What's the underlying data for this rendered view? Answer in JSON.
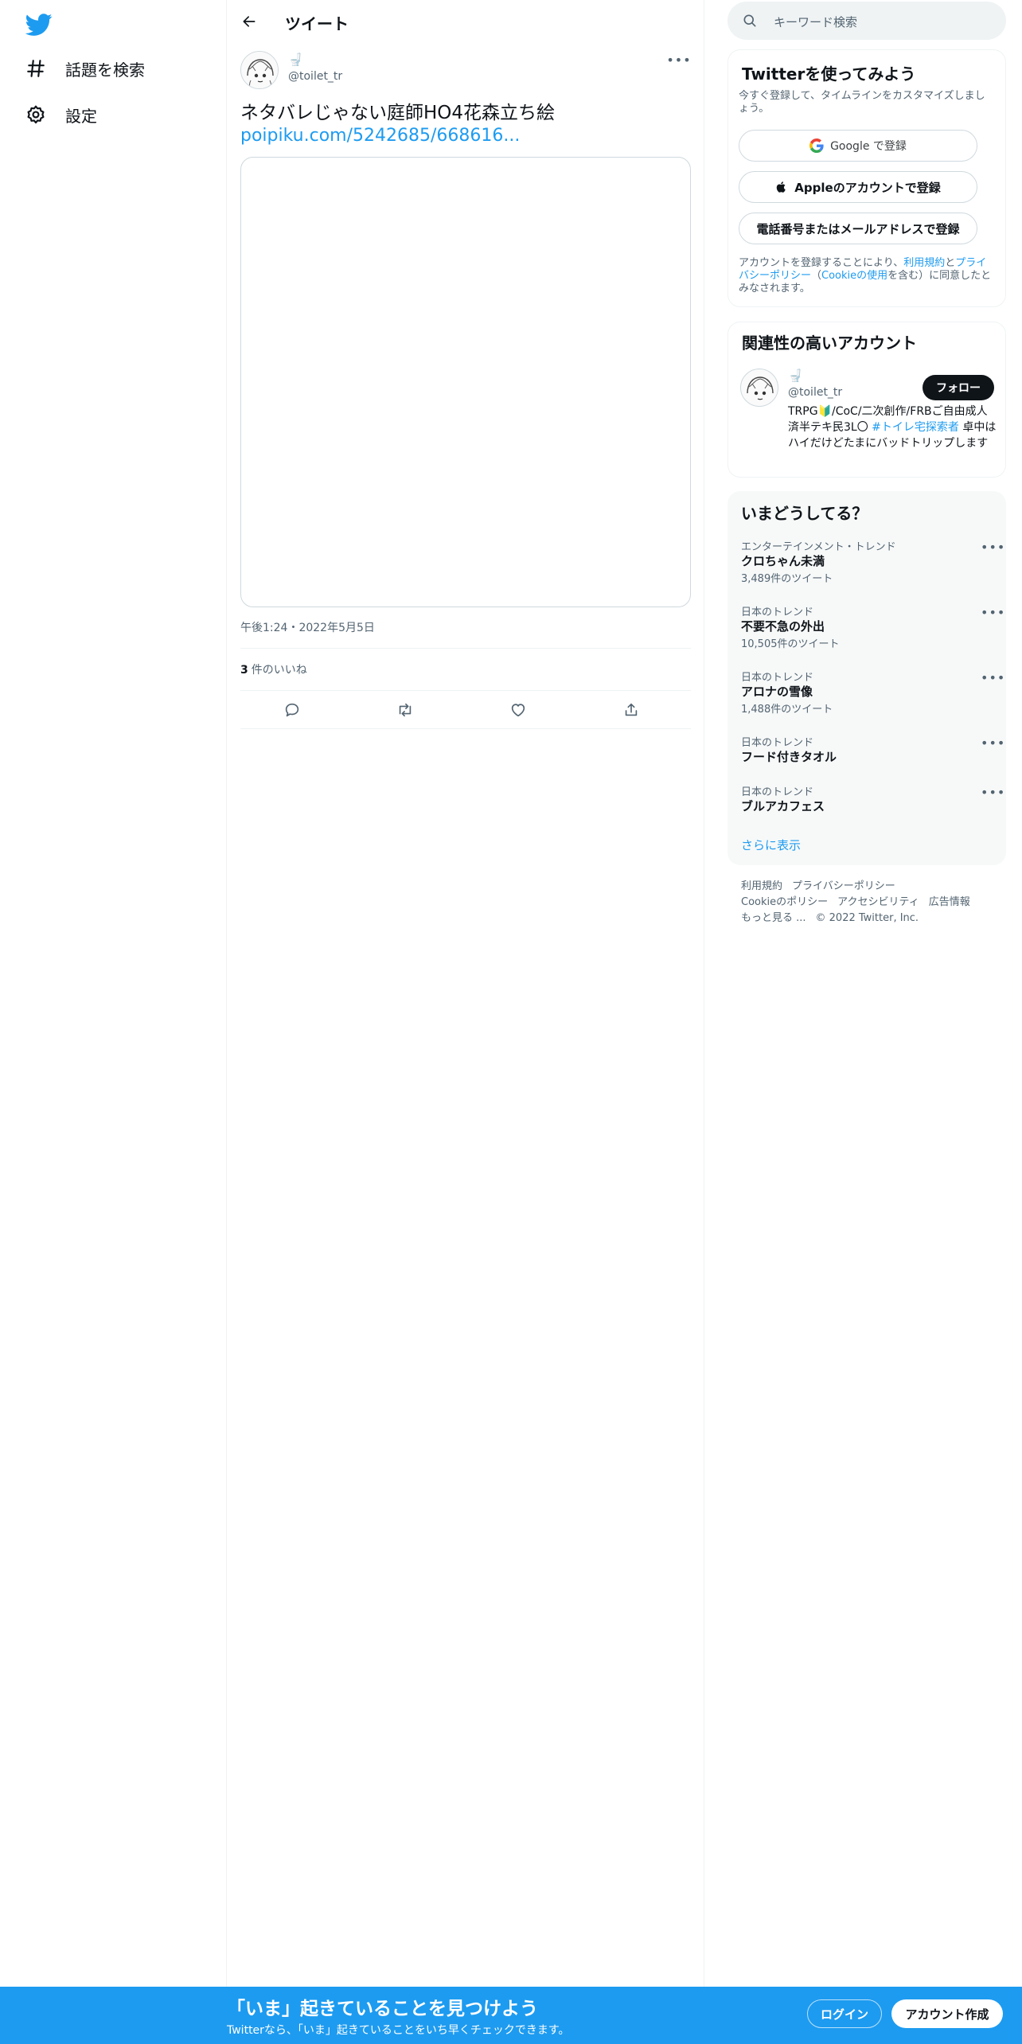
{
  "nav": {
    "explore_label": "話題を検索",
    "settings_label": "設定"
  },
  "header": {
    "title": "ツイート"
  },
  "tweet": {
    "author_name": "🚽",
    "author_handle": "@toilet_tr",
    "text": "ネタバレじゃない庭師HO4花森立ち絵",
    "link": "poipiku.com/5242685/668616...",
    "timestamp": "午後1:24・2022年5月5日",
    "likes_count": "3",
    "likes_label": "件のいいね"
  },
  "sidebar": {
    "search_placeholder": "キーワード検索",
    "signup_card": {
      "title": "Twitterを使ってみよう",
      "subtitle": "今すぐ登録して、タイムラインをカスタマイズしましょう。",
      "google_label": "Google で登録",
      "apple_label": "Appleのアカウントで登録",
      "phone_label": "電話番号またはメールアドレスで登録",
      "terms_prefix": "アカウントを登録することにより、",
      "terms_link": "利用規約",
      "terms_and": "と",
      "privacy_link": "プライバシーポリシー",
      "terms_paren_open": "（",
      "cookie_link": "Cookieの使用",
      "terms_suffix": "を含む）に同意したとみなされます。"
    },
    "related_card": {
      "title": "関連性の高いアカウント",
      "name": "🚽",
      "handle": "@toilet_tr",
      "follow_label": "フォロー",
      "bio": "TRPG🔰/CoC/二次創作/FRBご自由成人済半テキ民3L〇",
      "bio_hashtag": "#トイレ宅探索者",
      "bio_rest": "卓中はハイだけどたまにバッドトリップします"
    },
    "trends_card": {
      "title": "いまどうしてる？",
      "trends": [
        {
          "category": "エンターテインメント・トレンド",
          "name": "クロちゃん未満",
          "count": "3,489件のツイート"
        },
        {
          "category": "日本のトレンド",
          "name": "不要不急の外出",
          "count": "10,505件のツイート"
        },
        {
          "category": "日本のトレンド",
          "name": "アロナの雪像",
          "count": "1,488件のツイート"
        },
        {
          "category": "日本のトレンド",
          "name": "フード付きタオル",
          "count": ""
        },
        {
          "category": "日本のトレンド",
          "name": "ブルアカフェス",
          "count": ""
        }
      ],
      "show_more": "さらに表示"
    },
    "footer": {
      "terms": "利用規約",
      "privacy": "プライバシーポリシー",
      "cookies": "Cookieのポリシー",
      "accessibility": "アクセシビリティ",
      "ads": "広告情報",
      "more": "もっと見る ...",
      "copyright": "© 2022 Twitter, Inc."
    }
  },
  "bottom_bar": {
    "title": "「いま」起きていることを見つけよう",
    "subtitle": "Twitterなら、「いま」起きていることをいち早くチェックできます。",
    "login_label": "ログイン",
    "signup_label": "アカウント作成"
  },
  "colors": {
    "brand": "#1d9bf0",
    "text": "#0f1419",
    "secondary": "#536471"
  }
}
